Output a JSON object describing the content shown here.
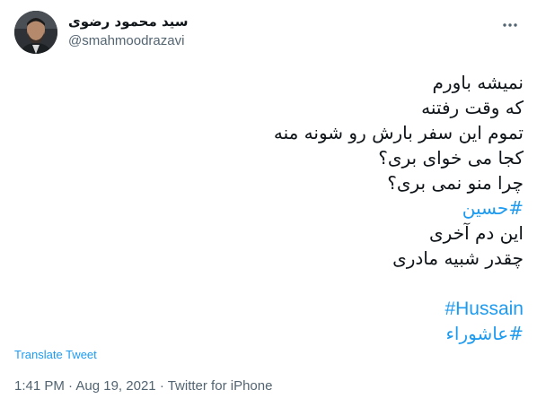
{
  "author": {
    "display_name": "سید محمود رضوی",
    "handle": "@smahmoodrazavi"
  },
  "more_icon": "more-horizontal-icon",
  "tweet": {
    "lines": [
      "نمیشه باورم",
      "که وقت رفتنه",
      "تموم این سفر بارش رو شونه منه",
      "کجا می خوای بری؟",
      "چرا منو نمی بری؟"
    ],
    "hashtag_hussain_fa": "#حسین",
    "lines_after": [
      "این دم آخری",
      "چقدر شبیه مادری"
    ],
    "hashtag_hussain_en": "#Hussain",
    "hashtag_ashura": "#عاشوراء"
  },
  "translate_label": "Translate Tweet",
  "meta": {
    "time": "1:41 PM",
    "separator": "·",
    "date": "Aug 19, 2021",
    "source": "Twitter for iPhone"
  },
  "colors": {
    "link": "#1d9bf0",
    "secondary_text": "#536471",
    "primary_text": "#0f1419"
  }
}
